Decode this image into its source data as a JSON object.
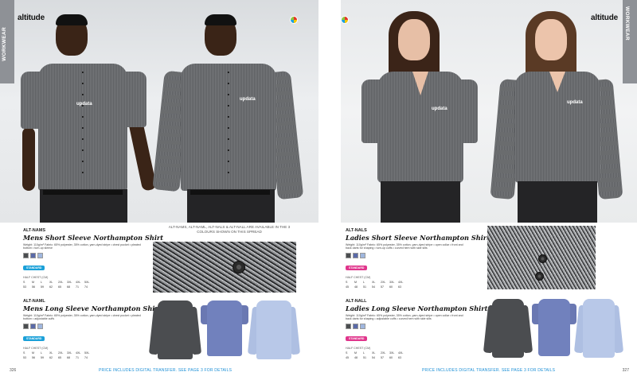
{
  "left_page": {
    "brand": "altitude",
    "tab_label": "WORKWEAR",
    "page_number": "326",
    "footer": "PRICE INCLUDES DIGITAL TRANSFER. SEE PAGE 3 FOR DETAILS",
    "shirt_logo": "updata",
    "availability_note": "ALT-NAMS, ALT-NAML, ALT-NALS & ALT-NALL ARE AVAILABLE IN THE 3 COLOURS SHOWN ON THIS SPREAD",
    "products": [
      {
        "code": "ALT-NAMS",
        "name": "Mens Short Sleeve Northampton Shirt",
        "description": "Weight: 110g/m² Fabric: 65% polyester, 35% cotton, yarn-dyed stripe • chest pocket • pleated bottom • turn-up sleeve",
        "embellishment": "STANDARD",
        "size_chart_title": "HALF CHEST (CM)",
        "sizes": [
          "S",
          "M",
          "L",
          "XL",
          "2XL",
          "3XL",
          "4XL",
          "5XL"
        ],
        "chest": [
          "53",
          "56",
          "59",
          "62",
          "65",
          "68",
          "71",
          "74"
        ]
      },
      {
        "code": "ALT-NAML",
        "name": "Mens Long Sleeve Northampton Shirt",
        "description": "Weight: 110g/m² Fabric: 65% polyester, 35% cotton, yarn-dyed stripe • chest pocket • pleated bottom • adjustable cuffs",
        "embellishment": "STANDARD",
        "size_chart_title": "HALF CHEST (CM)",
        "sizes": [
          "S",
          "M",
          "L",
          "XL",
          "2XL",
          "3XL",
          "4XL",
          "5XL"
        ],
        "chest": [
          "53",
          "56",
          "59",
          "62",
          "65",
          "68",
          "71",
          "74"
        ]
      }
    ]
  },
  "right_page": {
    "brand": "altitude",
    "tab_label": "WORKWEAR",
    "page_number": "327",
    "footer": "PRICE INCLUDES DIGITAL TRANSFER. SEE PAGE 3 FOR DETAILS",
    "shirt_logo": "updata",
    "products": [
      {
        "code": "ALT-NALS",
        "name": "Ladies Short Sleeve Northampton Shirt",
        "description": "Weight: 110g/m² Fabric: 65% polyester, 35% cotton, yarn-dyed stripe • open collar • front and back darts for shaping • turn-up cuffs • curved hem with side slits",
        "embellishment": "STANDARD",
        "size_chart_title": "HALF CHEST (CM)",
        "sizes": [
          "S",
          "M",
          "L",
          "XL",
          "2XL",
          "3XL",
          "4XL"
        ],
        "chest": [
          "45",
          "48",
          "51",
          "54",
          "57",
          "60",
          "63"
        ]
      },
      {
        "code": "ALT-NALL",
        "name": "Ladies Long Sleeve Northampton Shirt",
        "description": "Weight: 110g/m² Fabric: 65% polyester, 35% cotton, yarn-dyed stripe • open collar • front and back darts for shaping • adjustable cuffs • curved hem with side slits",
        "embellishment": "STANDARD",
        "size_chart_title": "HALF CHEST (CM)",
        "sizes": [
          "S",
          "M",
          "L",
          "XL",
          "2XL",
          "3XL",
          "4XL"
        ],
        "chest": [
          "45",
          "48",
          "51",
          "54",
          "57",
          "60",
          "63"
        ]
      }
    ]
  },
  "colors": {
    "grey": "#4b4d50",
    "navy": "#5a6aa8",
    "sky_blue": "#9fb6de",
    "link_blue": "#1b8fd6",
    "mens_standard_badge": "#1aa0d8",
    "ladies_standard_badge": "#e0358c",
    "tab_grey": "#8e9196"
  },
  "icons": [
    "product-colour-badge-icon"
  ]
}
